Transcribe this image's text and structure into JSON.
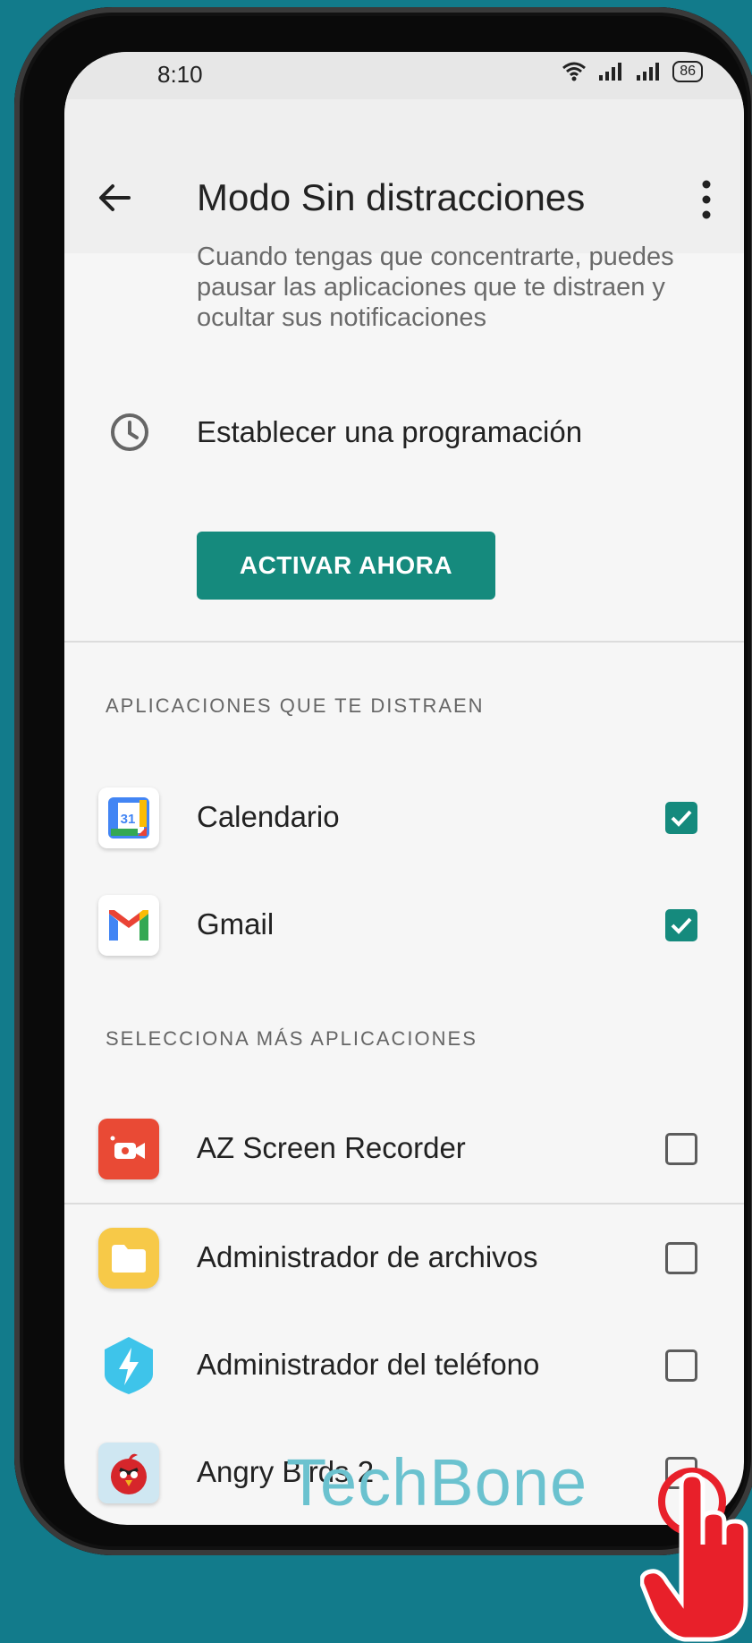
{
  "status_bar": {
    "time": "8:10",
    "battery": "86"
  },
  "app_bar": {
    "title": "Modo Sin distracciones"
  },
  "description": "Cuando tengas que concentrarte, puedes pausar las aplicaciones que te distraen y ocultar sus notificaciones",
  "schedule": {
    "label": "Establecer una programación"
  },
  "activate_button": "ACTIVAR AHORA",
  "sections": {
    "distracting": "APLICACIONES QUE TE DISTRAEN",
    "more": "SELECCIONA MÁS APLICACIONES"
  },
  "distracting_apps": [
    {
      "name": "Calendario",
      "checked": true,
      "icon": "calendar-icon"
    },
    {
      "name": "Gmail",
      "checked": true,
      "icon": "gmail-icon"
    }
  ],
  "more_apps": [
    {
      "name": "AZ Screen Recorder",
      "checked": false,
      "icon": "screen-recorder-icon"
    },
    {
      "name": "Administrador de archivos",
      "checked": false,
      "icon": "folder-icon"
    },
    {
      "name": "Administrador del teléfono",
      "checked": false,
      "icon": "phone-manager-icon"
    },
    {
      "name": "Angry Birds 2",
      "checked": false,
      "icon": "angry-birds-icon"
    }
  ],
  "calendar_icon_number": "31",
  "watermark": "TechBone",
  "colors": {
    "accent": "#158a7d",
    "background": "#127b8b"
  }
}
